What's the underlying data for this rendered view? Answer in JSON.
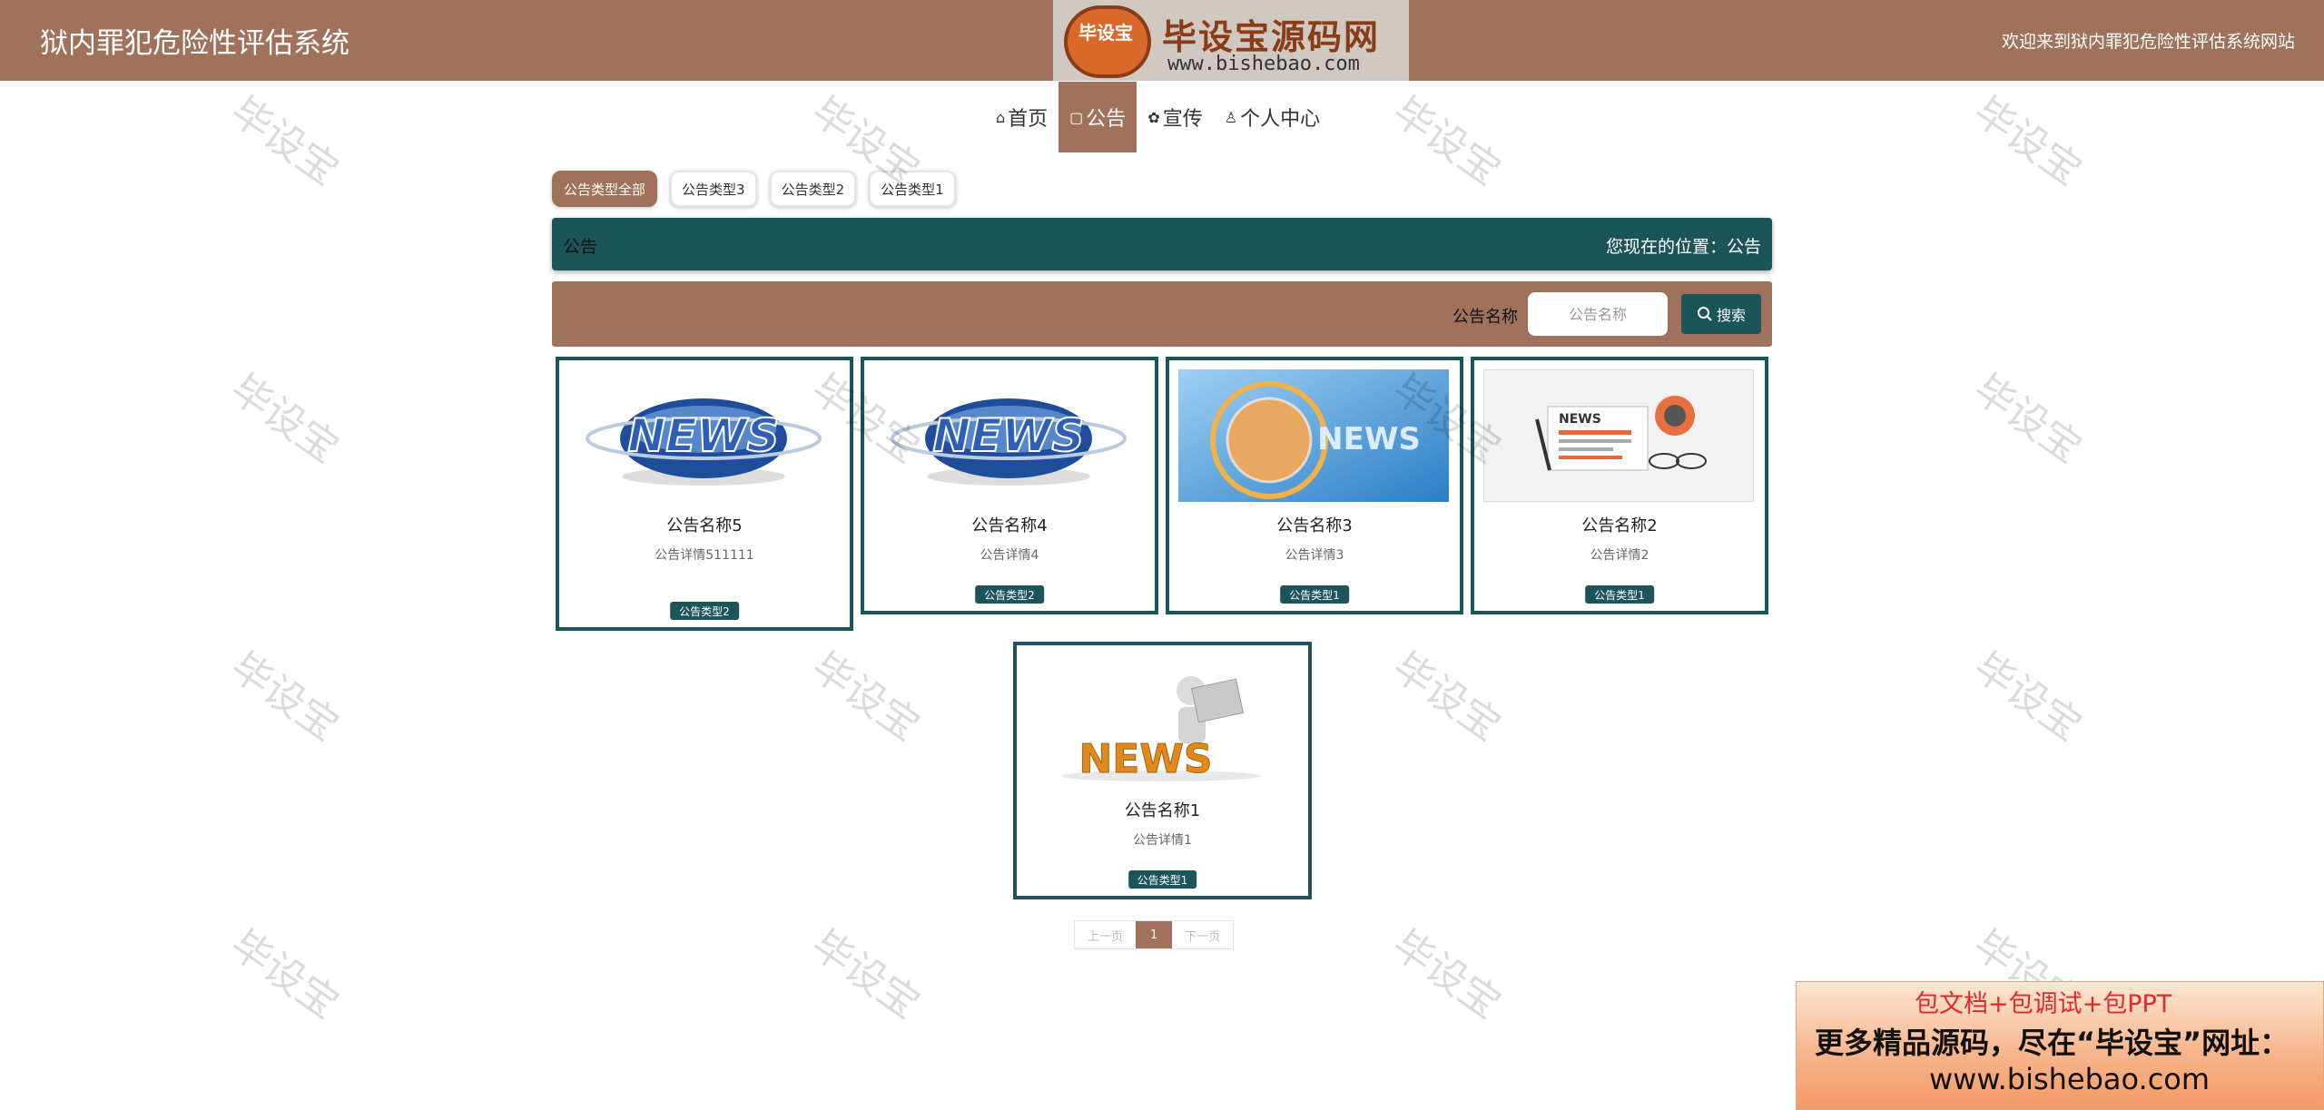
{
  "header": {
    "site_title": "狱内罪犯危险性评估系统",
    "welcome": "欢迎来到狱内罪犯危险性评估系统网站",
    "logo": {
      "emblem_text": "毕设宝",
      "name": "毕设宝源码网",
      "url": "www.bishebao.com"
    }
  },
  "nav": [
    {
      "label": "首页",
      "icon": "home-icon"
    },
    {
      "label": "公告",
      "icon": "note-icon",
      "active": true
    },
    {
      "label": "宣传",
      "icon": "flower-icon"
    },
    {
      "label": "个人中心",
      "icon": "user-icon"
    }
  ],
  "filters": [
    "公告类型全部",
    "公告类型3",
    "公告类型2",
    "公告类型1"
  ],
  "title_bar": {
    "title": "公告",
    "location": "您现在的位置：公告"
  },
  "search": {
    "label": "公告名称",
    "placeholder": "公告名称",
    "button": "搜索"
  },
  "cards": [
    {
      "title": "公告名称5",
      "detail": "公告详情511111",
      "tag": "公告类型2",
      "image": "news-globe"
    },
    {
      "title": "公告名称4",
      "detail": "公告详情4",
      "tag": "公告类型2",
      "image": "news-globe"
    },
    {
      "title": "公告名称3",
      "detail": "公告详情3",
      "tag": "公告类型1",
      "image": "news-broadcast"
    },
    {
      "title": "公告名称2",
      "detail": "公告详情2",
      "tag": "公告类型1",
      "image": "news-paper"
    },
    {
      "title": "公告名称1",
      "detail": "公告详情1",
      "tag": "公告类型1",
      "image": "news-figure"
    }
  ],
  "pagination": {
    "prev": "上一页",
    "current": "1",
    "next": "下一页"
  },
  "watermark": "毕设宝",
  "promo": {
    "line1": "包文档+包调试+包PPT",
    "line2": "更多精品源码，尽在“毕设宝”网址：",
    "line3": "www.bishebao.com"
  },
  "colors": {
    "brown": "#a0715b",
    "teal": "#1c545b"
  }
}
